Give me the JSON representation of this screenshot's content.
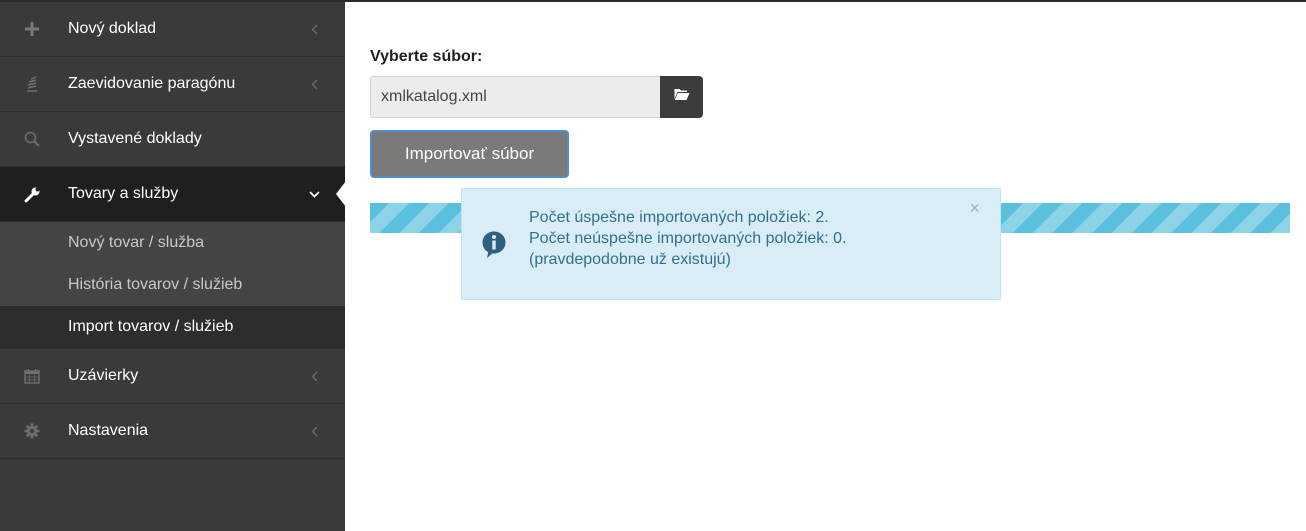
{
  "sidebar": {
    "items": [
      {
        "label": "Nový doklad",
        "icon": "plus-icon"
      },
      {
        "label": "Zaevidovanie paragónu",
        "icon": "receipt-icon"
      },
      {
        "label": "Vystavené doklady",
        "icon": "search-icon"
      },
      {
        "label": "Tovary a služby",
        "icon": "wrench-icon"
      },
      {
        "label": "Uzávierky",
        "icon": "calendar-icon"
      },
      {
        "label": "Nastavenia",
        "icon": "gear-icon"
      }
    ],
    "submenu": [
      {
        "label": "Nový tovar / služba"
      },
      {
        "label": "História tovarov / služieb"
      },
      {
        "label": "Import tovarov / služieb"
      }
    ]
  },
  "main": {
    "file_label": "Vyberte súbor:",
    "file_value": "xmlkatalog.xml",
    "import_button": "Importovať súbor",
    "progress": 1.0,
    "alert": {
      "line1": "Počet úspešne importovaných položiek: 2.",
      "line2": "Počet neúspešne importovaných položiek: 0.",
      "line3": "(pravdepodobne už existujú)",
      "close": "×"
    }
  },
  "colors": {
    "sidebar_bg": "#3a3a3a",
    "sidebar_active": "#1f1f1f",
    "progress": "#5bc0de",
    "alert_bg": "#d9edf7",
    "alert_text": "#31708f",
    "button_border": "#4c8fd4"
  }
}
